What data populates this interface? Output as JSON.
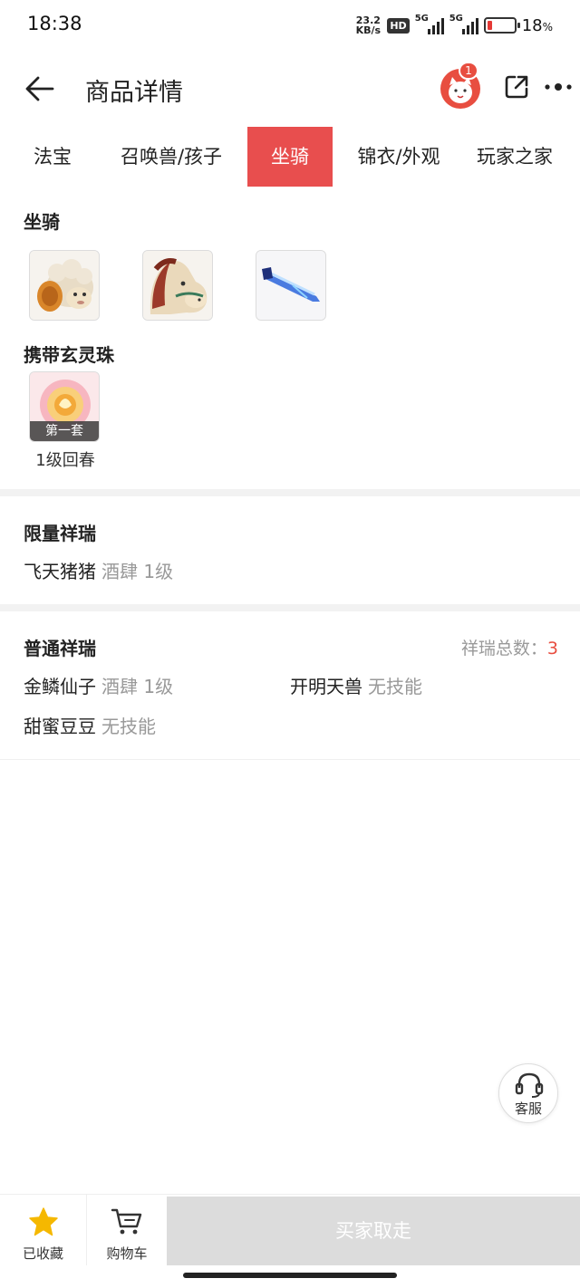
{
  "status_bar": {
    "time": "18:38",
    "net_speed_top": "23.2",
    "net_speed_bottom": "KB/s",
    "hd": "HD",
    "signal1": "5G",
    "signal2": "5G",
    "battery_level": 0.18,
    "battery_pct": "18",
    "battery_unit": "%"
  },
  "header": {
    "title": "商品详情",
    "badge_count": "1"
  },
  "tabs": [
    {
      "label": "法宝",
      "active": false
    },
    {
      "label": "召唤兽/孩子",
      "active": false
    },
    {
      "label": "坐骑",
      "active": true
    },
    {
      "label": "锦衣/外观",
      "active": false
    },
    {
      "label": "玩家之家",
      "active": false
    }
  ],
  "mount_section": {
    "title": "坐骑",
    "items": [
      {
        "icon": "sheep-mount-icon"
      },
      {
        "icon": "horse-mount-icon"
      },
      {
        "icon": "sword-mount-icon"
      }
    ]
  },
  "pearl_section": {
    "title": "携带玄灵珠",
    "set_label": "第一套",
    "caption": "1级回春"
  },
  "limited_section": {
    "title": "限量祥瑞",
    "items": [
      {
        "name": "飞天猪猪",
        "detail": "酒肆 1级"
      }
    ]
  },
  "normal_section": {
    "title": "普通祥瑞",
    "total_label": "祥瑞总数：",
    "total_value": "3",
    "items": [
      {
        "name": "金鳞仙子",
        "detail": "酒肆 1级"
      },
      {
        "name": "开明天兽",
        "detail": "无技能"
      },
      {
        "name": "甜蜜豆豆",
        "detail": "无技能"
      }
    ]
  },
  "service": {
    "label": "客服"
  },
  "bottom_bar": {
    "favorite_label": "已收藏",
    "cart_label": "购物车",
    "buy_label": "买家取走"
  },
  "colors": {
    "accent": "#e84e4e",
    "muted": "#999999",
    "favorite_star": "#f5b800"
  }
}
